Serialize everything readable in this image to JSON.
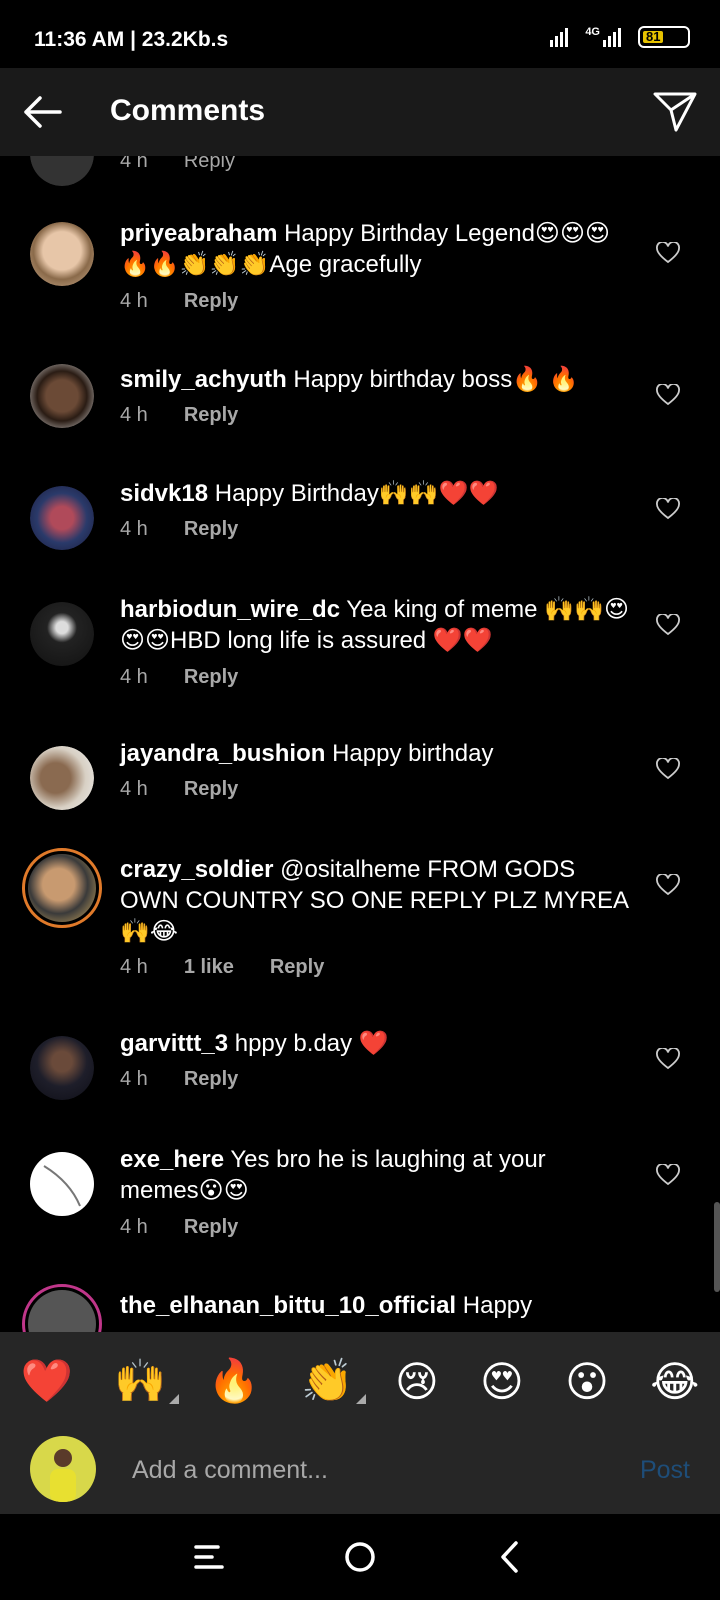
{
  "status": {
    "time": "11:36 AM | 23.2Kb.s",
    "network": "4G",
    "battery": "81"
  },
  "header": {
    "title": "Comments"
  },
  "partial_top": {
    "time": "4 h",
    "reply": "Reply"
  },
  "comments": [
    {
      "user": "priyeabraham",
      "text": "Happy Birthday Legend😍😍😍🔥🔥👏👏👏Age gracefully",
      "time": "4 h",
      "likes": "",
      "reply": "Reply"
    },
    {
      "user": "smily_achyuth",
      "text": "Happy birthday boss🔥 🔥",
      "time": "4 h",
      "likes": "",
      "reply": "Reply"
    },
    {
      "user": "sidvk18",
      "text": "Happy Birthday🙌🙌❤️❤️",
      "time": "4 h",
      "likes": "",
      "reply": "Reply"
    },
    {
      "user": "harbiodun_wire_dc",
      "text": "Yea king of meme 🙌🙌😍😍😍HBD long life is assured ❤️❤️",
      "time": "4 h",
      "likes": "",
      "reply": "Reply"
    },
    {
      "user": "jayandra_bushion",
      "text": "Happy birthday",
      "time": "4 h",
      "likes": "",
      "reply": "Reply"
    },
    {
      "user": "crazy_soldier",
      "text": "@ositalheme FROM GODS OWN COUNTRY SO ONE REPLY PLZ MYREA 🙌😂",
      "time": "4 h",
      "likes": "1 like",
      "reply": "Reply"
    },
    {
      "user": "garvittt_3",
      "text": "hppy b.day ❤️",
      "time": "4 h",
      "likes": "",
      "reply": "Reply"
    },
    {
      "user": "exe_here",
      "text": "Yes bro he is laughing at your memes😮😍",
      "time": "4 h",
      "likes": "",
      "reply": "Reply"
    },
    {
      "user": "the_elhanan_bittu_10_official",
      "text": "Happy",
      "time": "",
      "likes": "",
      "reply": ""
    }
  ],
  "reactions": [
    "❤️",
    "🙌",
    "🔥",
    "👏",
    "😢",
    "😍",
    "😮",
    "😂"
  ],
  "input": {
    "placeholder": "Add a comment...",
    "post": "Post"
  },
  "colors": {
    "header_bg": "#1a1a1a",
    "bar_bg": "#262626",
    "post_disabled": "#1e4d78",
    "meta": "#a8a8a8"
  }
}
